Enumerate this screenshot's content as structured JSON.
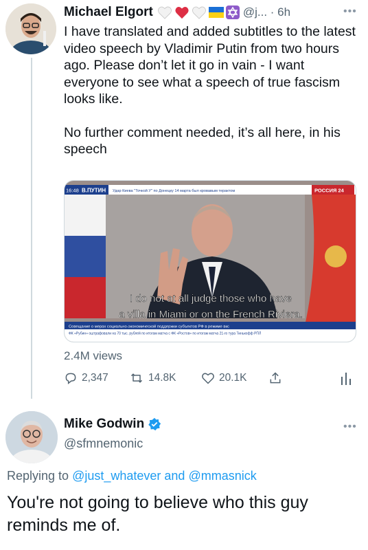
{
  "tweet1": {
    "author_name": "Michael Elgort",
    "handle_time": "@j... · 6h",
    "body_paragraphs": [
      "I have translated and added subtitles to the latest video speech by Vladimir Putin from two hours ago. Please don’t let it go in vain - I want everyone to see what a speech of true fascism looks like.",
      "No further comment needed, it’s all here, in his speech"
    ],
    "media": {
      "ticker_time": "16:48",
      "ticker_name": "В.ПУТИН",
      "ticker_headline": "Удар Киева \"Точкой У\" по Донецку 14 марта был кровавым терактом",
      "channel_logo": "РОССИЯ 24",
      "subtitle_line1": "I do not at all judge those who have",
      "subtitle_line2": "a villa in Miami or on the French Riviera.",
      "lower_bar": "Совещание о мерах социально-экономической поддержки субъектов РФ в режиме вкс",
      "crawl": "ФК «Рубин» оштрафовали на 70 тыс. рублей по итогам матча с ФК «Ростов» по итогам матча 21-го тура Тинькофф РПЛ"
    },
    "views": "2.4M views",
    "actions": {
      "replies": "2,347",
      "retweets": "14.8K",
      "likes": "20.1K"
    }
  },
  "tweet2": {
    "author_name": "Mike Godwin",
    "handle": "@sfmnemonic",
    "replying_prefix": "Replying to",
    "replying_to": "@just_whatever and @mmasnick",
    "body": "You're not going to believe who this guy reminds me of."
  },
  "colors": {
    "accent": "#1d9bf0",
    "secondary_text": "#536471",
    "verified": "#1d9bf0"
  }
}
